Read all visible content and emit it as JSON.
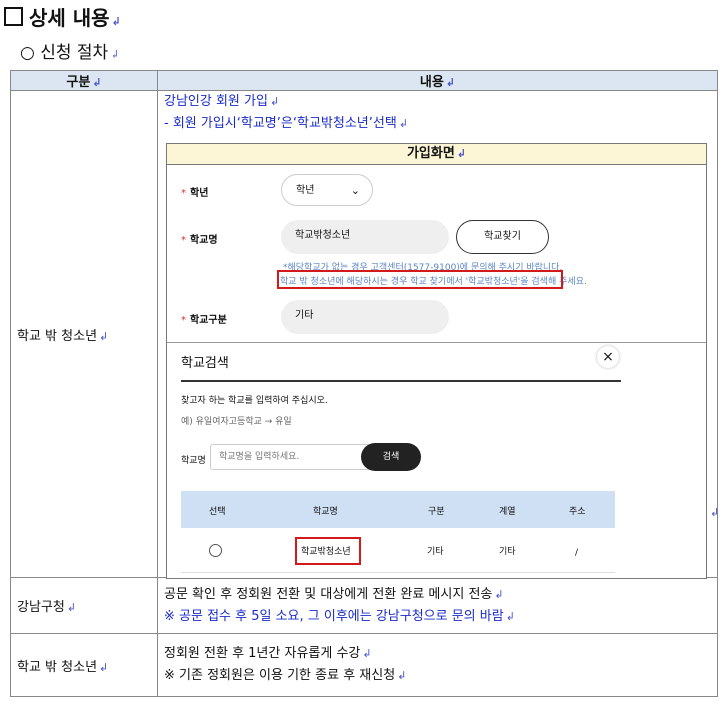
{
  "section_title": "상세 내용",
  "sub_title": "○ 신청 절차",
  "return_mark": "↲",
  "table": {
    "headers": [
      "구분",
      "내용"
    ],
    "rows": [
      {
        "label": "학교 밖 청소년",
        "lines": [
          "강남인강 회원 가입",
          "- 회원 가입시‘학교명’은‘학교밖청소년’선택"
        ]
      },
      {
        "label": "강남구청",
        "lines": [
          "공문 확인 후 정회원 전환 및 대상에게 전환 완료 메시지 전송",
          "※ 공문 접수 후 5일 소요, 그 이후에는 강남구청으로 문의 바람"
        ]
      },
      {
        "label": "학교 밖 청소년",
        "lines": [
          "정회원 전환 후 1년간 자유롭게 수강",
          "※ 기존 정회원은 이용 기한 종료 후 재신청"
        ]
      }
    ]
  },
  "screenshot": {
    "header": "가입화면",
    "grade_label": "학년",
    "grade_value": "학년",
    "school_label": "학교명",
    "school_value": "학교밖청소년",
    "find_button": "학교찾기",
    "note1": "*해당학교가 없는 경우 고객센터(1577-9100)에 문의해 주시기 바랍니다.",
    "note2": "학교 밖 청소년에 해당하시는 경우 학교 찾기에서 '학교밖청소년'을 검색해 주세요.",
    "type_label": "학교구분",
    "type_value": "기타",
    "modal": {
      "title": "학교검색",
      "close": "×",
      "instruction": "찾고자 하는 학교를 입력하여 주십시오.",
      "example": "예) 유일여자고등학교 → 유일",
      "field_label": "학교명",
      "placeholder": "학교명을 입력하세요.",
      "search_button": "검색",
      "columns": [
        "선택",
        "학교명",
        "구분",
        "계열",
        "주소"
      ],
      "row": {
        "school": "학교밖청소년",
        "type": "기타",
        "track": "기타",
        "address": "/"
      }
    }
  }
}
